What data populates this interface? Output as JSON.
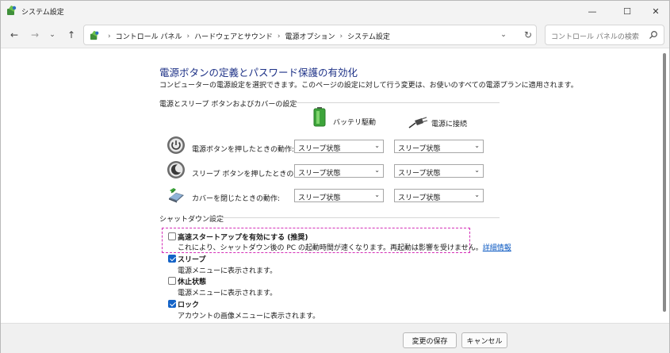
{
  "window": {
    "title": "システム設定",
    "controls": {
      "minimize": "—",
      "maximize": "☐",
      "close": "✕"
    }
  },
  "nav": {
    "back": "←",
    "forward": "→",
    "recent": "⌄",
    "up": "↑",
    "breadcrumbs": [
      "コントロール パネル",
      "ハードウェアとサウンド",
      "電源オプション",
      "システム設定"
    ],
    "separator": "›",
    "dropdown": "⌄",
    "refresh": "↻"
  },
  "search": {
    "placeholder": "コントロール パネルの検索"
  },
  "page": {
    "title": "電源ボタンの定義とパスワード保護の有効化",
    "description": "コンピューターの電源設定を選択できます。このページの設定に対して行う変更は、お使いのすべての電源プランに適用されます。"
  },
  "power_section": {
    "heading": "電源とスリープ ボタンおよびカバーの設定",
    "col_battery": "バッテリ駆動",
    "col_plugged": "電源に接続",
    "rows": [
      {
        "label": "電源ボタンを押したときの動作:",
        "battery": "スリープ状態",
        "plugged": "スリープ状態",
        "icon": "power-icon"
      },
      {
        "label": "スリープ ボタンを押したときの動作:",
        "battery": "スリープ状態",
        "plugged": "スリープ状態",
        "icon": "sleep-icon"
      },
      {
        "label": "カバーを閉じたときの動作:",
        "battery": "スリープ状態",
        "plugged": "スリープ状態",
        "icon": "laptop-lid-icon"
      }
    ]
  },
  "shutdown_section": {
    "heading": "シャットダウン設定",
    "options": [
      {
        "label": "高速スタートアップを有効にする (推奨)",
        "desc": "これにより、シャットダウン後の PC の起動時間が速くなります。再起動は影響を受けません。",
        "link": "詳細情報",
        "checked": false
      },
      {
        "label": "スリープ",
        "desc": "電源メニューに表示されます。",
        "checked": true
      },
      {
        "label": "休止状態",
        "desc": "電源メニューに表示されます。",
        "checked": false
      },
      {
        "label": "ロック",
        "desc": "アカウントの画像メニューに表示されます。",
        "checked": true
      }
    ]
  },
  "footer": {
    "save": "変更の保存",
    "cancel": "キャンセル"
  },
  "colors": {
    "title_blue": "#1e3287",
    "check_blue": "#1463c7",
    "link_blue": "#0a58c2",
    "highlight_magenta": "#d42fb8"
  }
}
